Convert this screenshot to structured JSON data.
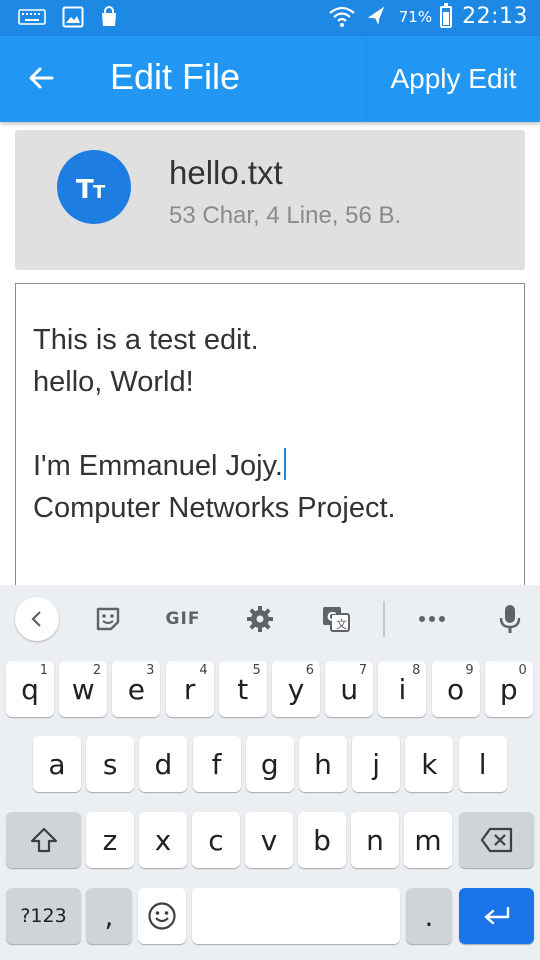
{
  "status_bar": {
    "battery": "71%",
    "time": "22:13",
    "icons": [
      "keyboard-icon",
      "image-icon",
      "shopping-bag-icon",
      "wifi-icon",
      "airplane-icon",
      "battery-icon"
    ]
  },
  "app_bar": {
    "title": "Edit File",
    "apply_label": "Apply Edit"
  },
  "file": {
    "avatar_text": "Tт",
    "name": "hello.txt",
    "meta": "53 Char, 4 Line, 56 B."
  },
  "editor": {
    "lines": [
      "This is a test edit.",
      "hello, World!",
      "",
      "I'm Emmanuel Jojy.",
      "Computer Networks Project."
    ]
  },
  "keyboard": {
    "toolbar": {
      "gif": "GIF"
    },
    "row1": [
      {
        "k": "q",
        "h": "1"
      },
      {
        "k": "w",
        "h": "2"
      },
      {
        "k": "e",
        "h": "3"
      },
      {
        "k": "r",
        "h": "4"
      },
      {
        "k": "t",
        "h": "5"
      },
      {
        "k": "y",
        "h": "6"
      },
      {
        "k": "u",
        "h": "7"
      },
      {
        "k": "i",
        "h": "8"
      },
      {
        "k": "o",
        "h": "9"
      },
      {
        "k": "p",
        "h": "0"
      }
    ],
    "row2": [
      "a",
      "s",
      "d",
      "f",
      "g",
      "h",
      "j",
      "k",
      "l"
    ],
    "row3": [
      "z",
      "x",
      "c",
      "v",
      "b",
      "n",
      "m"
    ],
    "sym_label": "?123",
    "comma": ",",
    "period": "."
  },
  "colors": {
    "accent": "#2196f3",
    "status": "#1e88e5",
    "enter": "#1a73e8"
  }
}
